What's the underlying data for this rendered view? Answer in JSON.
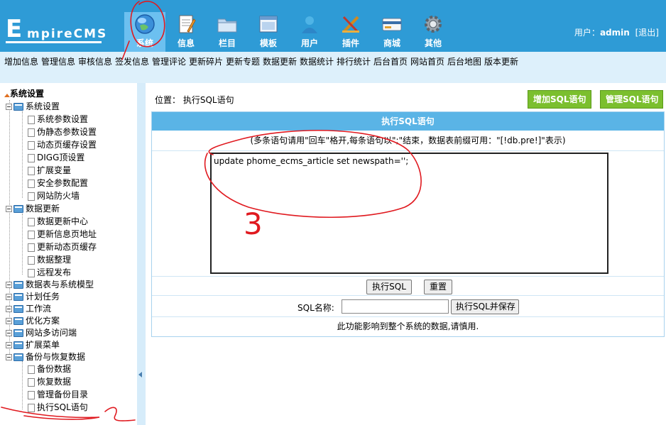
{
  "header": {
    "logo_first": "E",
    "logo_rest": "mpireCMS",
    "nav": [
      {
        "label": "系统",
        "icon": "globe-icon",
        "active": true
      },
      {
        "label": "信息",
        "icon": "notepad-icon",
        "active": false
      },
      {
        "label": "栏目",
        "icon": "folder-icon",
        "active": false
      },
      {
        "label": "模板",
        "icon": "window-icon",
        "active": false
      },
      {
        "label": "用户",
        "icon": "user-icon",
        "active": false
      },
      {
        "label": "插件",
        "icon": "tools-icon",
        "active": false
      },
      {
        "label": "商城",
        "icon": "credit-card-icon",
        "active": false
      },
      {
        "label": "其他",
        "icon": "gear-icon",
        "active": false
      }
    ],
    "user_label": "用户：",
    "user_name": "admin",
    "logout": "[退出]"
  },
  "sub_nav": [
    "增加信息",
    "管理信息",
    "审核信息",
    "签发信息",
    "管理评论",
    "更新碎片",
    "更新专题",
    "数据更新",
    "数据统计",
    "排行统计",
    "后台首页",
    "网站首页",
    "后台地图",
    "版本更新"
  ],
  "sidebar": {
    "root": "系统设置",
    "groups": [
      {
        "label": "系统设置",
        "children": [
          "系统参数设置",
          "伪静态参数设置",
          "动态页缓存设置",
          "DIGG顶设置",
          "扩展变量",
          "安全参数配置",
          "网站防火墙"
        ]
      },
      {
        "label": "数据更新",
        "children": [
          "数据更新中心",
          "更新信息页地址",
          "更新动态页缓存",
          "数据整理",
          "远程发布"
        ]
      },
      {
        "label": "数据表与系统模型",
        "children": []
      },
      {
        "label": "计划任务",
        "children": []
      },
      {
        "label": "工作流",
        "children": []
      },
      {
        "label": "优化方案",
        "children": []
      },
      {
        "label": "网站多访问端",
        "children": []
      },
      {
        "label": "扩展菜单",
        "children": []
      },
      {
        "label": "备份与恢复数据",
        "children": [
          "备份数据",
          "恢复数据",
          "管理备份目录",
          "执行SQL语句"
        ]
      }
    ]
  },
  "main": {
    "location_label": "位置：",
    "location_value": "执行SQL语句",
    "add_sql_button": "增加SQL语句",
    "manage_sql_button": "管理SQL语句",
    "panel_title": "执行SQL语句",
    "tip": "(多条语句请用\"回车\"格开,每条语句以\";\"结束，数据表前缀可用：\"[!db.pre!]\"表示)",
    "sql_text": "update phome_ecms_article set newspath=''; ",
    "exec_button": "执行SQL",
    "reset_button": "重置",
    "sql_name_label": "SQL名称:",
    "sql_name_value": "",
    "exec_save_button": "执行SQL并保存",
    "warning": "此功能影响到整个系统的数据,请慎用."
  },
  "annotations": {
    "handwritten_number": "3"
  },
  "colors": {
    "header_bg": "#2e9bd6",
    "active_tab": "#6cc0f0",
    "sub_nav_bg": "#ddf0fb",
    "panel_head": "#5ab4e6",
    "green_button": "#7bbf2e",
    "annotation_red": "#e0191f"
  }
}
